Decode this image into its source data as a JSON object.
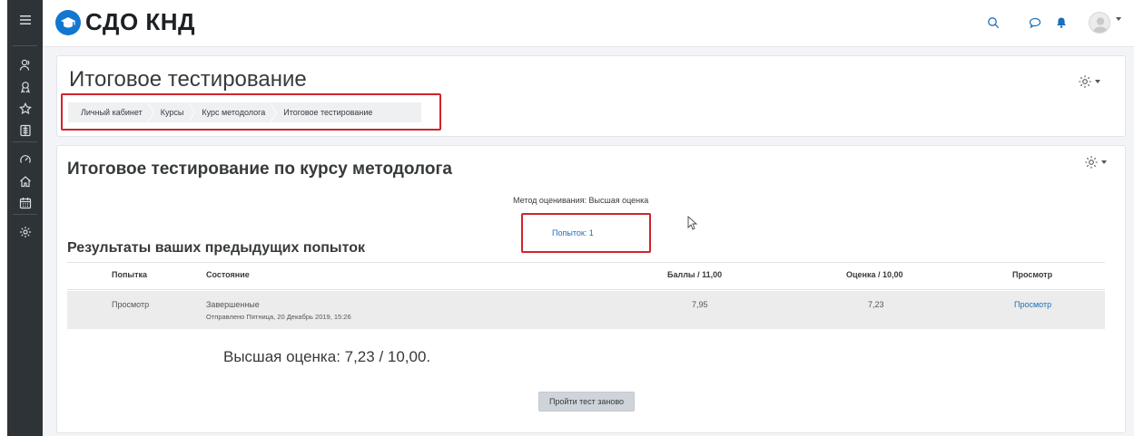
{
  "site": {
    "name": "СДО КНД"
  },
  "page": {
    "title": "Итоговое тестирование"
  },
  "breadcrumb": [
    "Личный кабинет",
    "Курсы",
    "Курс методолога",
    "Итоговое тестирование"
  ],
  "quiz": {
    "title": "Итоговое тестирование по курсу методолога",
    "grading_method": "Метод оценивания: Высшая оценка",
    "attempts_link": "Попыток: 1"
  },
  "results": {
    "heading": "Результаты ваших предыдущих попыток",
    "columns": [
      "Попытка",
      "Состояние",
      "Баллы / 11,00",
      "Оценка / 10,00",
      "Просмотр"
    ],
    "rows": [
      {
        "attempt": "Просмотр",
        "state": "Завершенные",
        "submitted": "Отправлено Пятница, 20 Декабрь 2019, 15:26",
        "marks": "7,95",
        "grade": "7,23",
        "review": "Просмотр"
      }
    ]
  },
  "best_grade": "Высшая оценка: 7,23 / 10,00.",
  "retake_button": "Пройти тест заново",
  "icons": {
    "sidebar": [
      "menu-icon",
      "participants-icon",
      "badges-icon",
      "star-icon",
      "grades-icon",
      "dashboard-icon",
      "home-icon",
      "calendar-icon",
      "settings-icon"
    ],
    "navbar": [
      "search-icon",
      "messages-icon",
      "notifications-icon",
      "user-avatar-icon"
    ]
  },
  "colors": {
    "sidebar_bg": "#2e3338",
    "brand_blue": "#1177d1",
    "highlight_red": "#d0242b",
    "link_blue": "#1a6fb8"
  }
}
